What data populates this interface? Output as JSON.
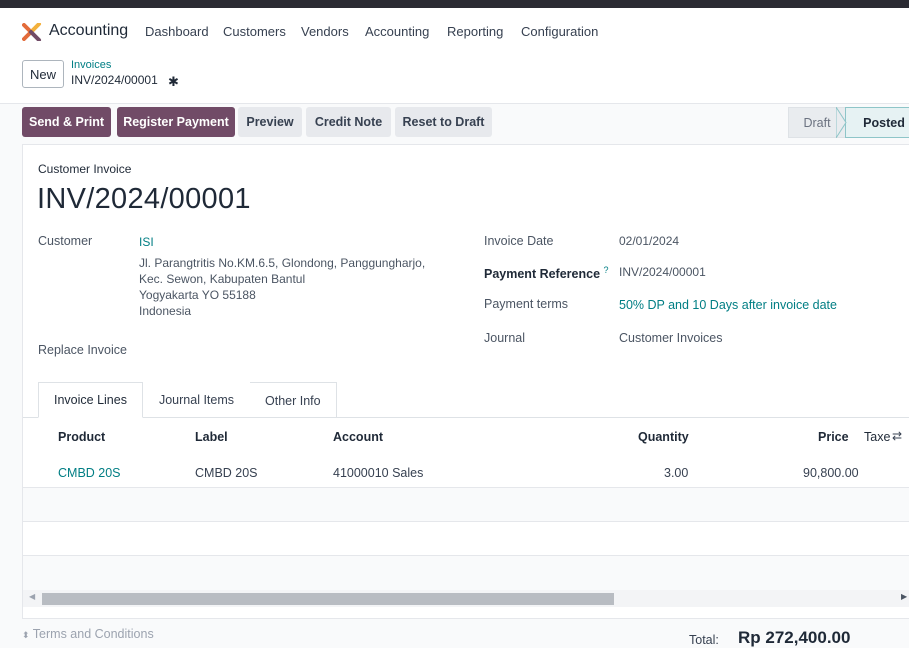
{
  "navbar": {
    "app_name": "Accounting",
    "menu": [
      "Dashboard",
      "Customers",
      "Vendors",
      "Accounting",
      "Reporting",
      "Configuration"
    ]
  },
  "breadcrumb": {
    "new_label": "New",
    "parent": "Invoices",
    "current": "INV/2024/00001"
  },
  "actions": {
    "send_print": "Send & Print",
    "register_payment": "Register Payment",
    "preview": "Preview",
    "credit_note": "Credit Note",
    "reset_to_draft": "Reset to Draft"
  },
  "status": {
    "stages": [
      "Draft",
      "Posted"
    ],
    "current": "Posted"
  },
  "invoice": {
    "type": "Customer Invoice",
    "name": "INV/2024/00001",
    "customer_label": "Customer",
    "customer_name": "ISI",
    "address_lines": [
      "Jl. Parangtritis No.KM.6.5, Glondong, Panggungharjo,",
      "Kec. Sewon, Kabupaten Bantul",
      "Yogyakarta YO 55188",
      "Indonesia"
    ],
    "replace_invoice_label": "Replace Invoice",
    "invoice_date_label": "Invoice Date",
    "invoice_date": "02/01/2024",
    "payment_reference_label": "Payment Reference",
    "payment_reference_help": "?",
    "payment_reference": "INV/2024/00001",
    "payment_terms_label": "Payment terms",
    "payment_terms": "50% DP and 10 Days after invoice date",
    "journal_label": "Journal",
    "journal": "Customer Invoices"
  },
  "tabs": [
    "Invoice Lines",
    "Journal Items",
    "Other Info"
  ],
  "lines": {
    "headers": {
      "product": "Product",
      "label": "Label",
      "account": "Account",
      "quantity": "Quantity",
      "price": "Price",
      "taxes": "Taxe"
    },
    "rows": [
      {
        "product": "CMBD 20S",
        "label": "CMBD 20S",
        "account": "41000010 Sales",
        "quantity": "3.00",
        "price": "90,800.00"
      }
    ]
  },
  "footer": {
    "terms": "Terms and Conditions",
    "total_label": "Total:",
    "total_value": "Rp 272,400.00"
  },
  "colors": {
    "primary": "#714b67",
    "link": "#017e84"
  }
}
